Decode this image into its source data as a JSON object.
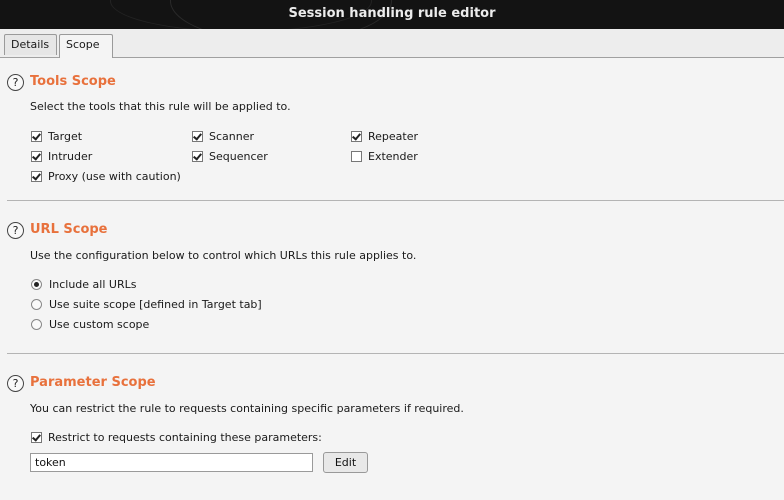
{
  "window": {
    "title": "Session handling rule editor"
  },
  "tabs": [
    {
      "label": "Details"
    },
    {
      "label": "Scope"
    }
  ],
  "help_icon_glyph": "?",
  "tools_scope": {
    "title": "Tools Scope",
    "description": "Select the tools that this rule will be applied to.",
    "tools": [
      {
        "label": "Target",
        "checked": true
      },
      {
        "label": "Scanner",
        "checked": true
      },
      {
        "label": "Repeater",
        "checked": true
      },
      {
        "label": "Intruder",
        "checked": true
      },
      {
        "label": "Sequencer",
        "checked": true
      },
      {
        "label": "Extender",
        "checked": false
      },
      {
        "label": "Proxy (use with caution)",
        "checked": true
      }
    ]
  },
  "url_scope": {
    "title": "URL Scope",
    "description": "Use the configuration below to control which URLs this rule applies to.",
    "options": [
      {
        "label": "Include all URLs",
        "selected": true
      },
      {
        "label": "Use suite scope [defined in Target tab]",
        "selected": false
      },
      {
        "label": "Use custom scope",
        "selected": false
      }
    ]
  },
  "parameter_scope": {
    "title": "Parameter Scope",
    "description": "You can restrict the rule to requests containing specific parameters if required.",
    "restrict_label": "Restrict to requests containing these parameters:",
    "restrict_checked": true,
    "parameters_value": "token",
    "edit_label": "Edit"
  },
  "colors": {
    "section_title": "#e8713c",
    "titlebar_bg": "#131313"
  }
}
